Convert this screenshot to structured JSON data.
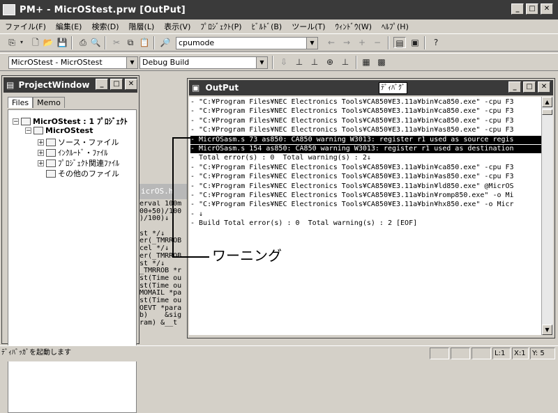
{
  "window": {
    "title": "PM+ - MicrOStest.prw [OutPut]"
  },
  "menu": [
    "ファイル(F)",
    "編集(E)",
    "検索(D)",
    "階層(L)",
    "表示(V)",
    "ﾌﾟﾛｼﾞｪｸﾄ(P)",
    "ﾋﾞﾙﾄﾞ(B)",
    "ツール(T)",
    "ｳｨﾝﾄﾞｳ(W)",
    "ﾍﾙﾌﾟ(H)"
  ],
  "toolbar": {
    "search_value": "cpumode"
  },
  "toolbar2": {
    "project_combo": "MicrOStest - MicrOStest",
    "config_combo": "Debug Build"
  },
  "project_window": {
    "title": "ProjectWindow",
    "tabs": [
      "Files",
      "Memo"
    ],
    "tree": [
      {
        "label": "MicrOStest : 1 ﾌﾟﾛｼﾞｪｸﾄ",
        "level": 0,
        "bold": true,
        "toggle": "-"
      },
      {
        "label": "MicrOStest",
        "level": 1,
        "bold": true,
        "toggle": "-"
      },
      {
        "label": "ソース・ファイル",
        "level": 2,
        "bold": false,
        "toggle": "+"
      },
      {
        "label": "ｲﾝｸﾙｰﾄﾞ・ﾌｧｲﾙ",
        "level": 2,
        "bold": false,
        "toggle": "+"
      },
      {
        "label": "ﾌﾟﾛｼﾞｪｸﾄ関連ﾌｧｲﾙ",
        "level": 2,
        "bold": false,
        "toggle": "+"
      },
      {
        "label": "その他のファイル",
        "level": 2,
        "bold": false,
        "toggle": ""
      }
    ]
  },
  "background_editor": {
    "tab_label": "icrOS.h",
    "lines": [
      "erval 100m",
      "00+50)/100",
      ")/100)↓",
      "",
      "st */↓",
      "er(_TMRROB",
      "cel */↓",
      "er(_TMRROB",
      "st */↓",
      "_TMRROB *r",
      "st(Time ou",
      "st(Time ou",
      "MOMAIL *pa",
      "st(Time ou",
      "OEVT *para",
      "b)    &sig",
      "ram) &__t"
    ]
  },
  "output": {
    "title": "OutPut",
    "tooltip": "ﾃﾞｨﾊﾞｸﾞ",
    "lines": [
      {
        "text": "- \"C:¥Program Files¥NEC Electronics Tools¥CA850¥E3.11a¥bin¥ca850.exe\" -cpu F3",
        "highlight": false
      },
      {
        "text": "- \"C:¥Program Files¥NEC Electronics Tools¥CA850¥E3.11a¥bin¥ca850.exe\" -cpu F3",
        "highlight": false
      },
      {
        "text": "- \"C:¥Program Files¥NEC Electronics Tools¥CA850¥E3.11a¥bin¥ca850.exe\" -cpu F3",
        "highlight": false
      },
      {
        "text": "- \"C:¥Program Files¥NEC Electronics Tools¥CA850¥E3.11a¥bin¥as850.exe\" -cpu F3",
        "highlight": false
      },
      {
        "text": "- MicrOSasm.s 73 as850: CA850 warning W3013: register r1 used as source regis",
        "highlight": true
      },
      {
        "text": "- MicrOSasm.s 154 as850: CA850 warning W3013: register r1 used as destination",
        "highlight": true
      },
      {
        "text": "- Total error(s) : 0  Total warning(s) : 2↓",
        "highlight": false
      },
      {
        "text": "- \"C:¥Program Files¥NEC Electronics Tools¥CA850¥E3.11a¥bin¥ca850.exe\" -cpu F3",
        "highlight": false
      },
      {
        "text": "- \"C:¥Program Files¥NEC Electronics Tools¥CA850¥E3.11a¥bin¥as850.exe\" -cpu F3",
        "highlight": false
      },
      {
        "text": "- \"C:¥Program Files¥NEC Electronics Tools¥CA850¥E3.11a¥bin¥ld850.exe\" @MicrOS",
        "highlight": false
      },
      {
        "text": "- \"C:¥Program Files¥NEC Electronics Tools¥CA850¥E3.11a¥bin¥romp850.exe\" -o Mi",
        "highlight": false
      },
      {
        "text": "- \"C:¥Program Files¥NEC Electronics Tools¥CA850¥E3.11a¥bin¥hx850.exe\" -o Micr",
        "highlight": false
      },
      {
        "text": "- ↓",
        "highlight": false
      },
      {
        "text": "- Build Total error(s) : 0  Total warning(s) : 2 [EOF]",
        "highlight": false
      }
    ]
  },
  "annotation": {
    "label": "ワーニング"
  },
  "status": {
    "message": "ﾃﾞｨﾊﾞｯｶﾞを起動します",
    "line": "L:1",
    "col": "X:1",
    "y": "Y: 5"
  }
}
